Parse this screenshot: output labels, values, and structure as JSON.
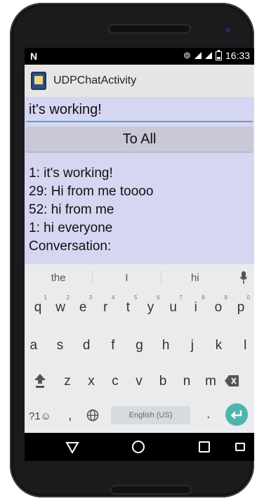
{
  "status_bar": {
    "notification_glyph": "N",
    "time": "16:33",
    "icons": [
      "hotspot-icon",
      "signal-icon",
      "signal-icon",
      "battery-icon"
    ]
  },
  "action_bar": {
    "title": "UDPChatActivity",
    "app_icon": "app-icon"
  },
  "compose": {
    "value": "it's working!"
  },
  "send_button": {
    "label": "To All"
  },
  "messages": [
    "1: it's working!",
    "29: Hi from me toooo",
    "52: hi from me",
    "1: hi everyone",
    "Conversation:"
  ],
  "keyboard": {
    "suggestions": [
      "the",
      "I",
      "hi"
    ],
    "row1": [
      {
        "key": "q",
        "hint": "1"
      },
      {
        "key": "w",
        "hint": "2"
      },
      {
        "key": "e",
        "hint": "3"
      },
      {
        "key": "r",
        "hint": "4"
      },
      {
        "key": "t",
        "hint": "5"
      },
      {
        "key": "y",
        "hint": "6"
      },
      {
        "key": "u",
        "hint": "7"
      },
      {
        "key": "i",
        "hint": "8"
      },
      {
        "key": "o",
        "hint": "9"
      },
      {
        "key": "p",
        "hint": "0"
      }
    ],
    "row2": [
      "a",
      "s",
      "d",
      "f",
      "g",
      "h",
      "j",
      "k",
      "l"
    ],
    "row3": [
      "z",
      "x",
      "c",
      "v",
      "b",
      "n",
      "m"
    ],
    "symbols_label": "?1☺",
    "comma": ",",
    "space_label": "English (US)",
    "period": "."
  },
  "colors": {
    "content_bg": "#d6d6f3",
    "accent": "#5aa6c6",
    "enter_key": "#4cb6ac"
  }
}
